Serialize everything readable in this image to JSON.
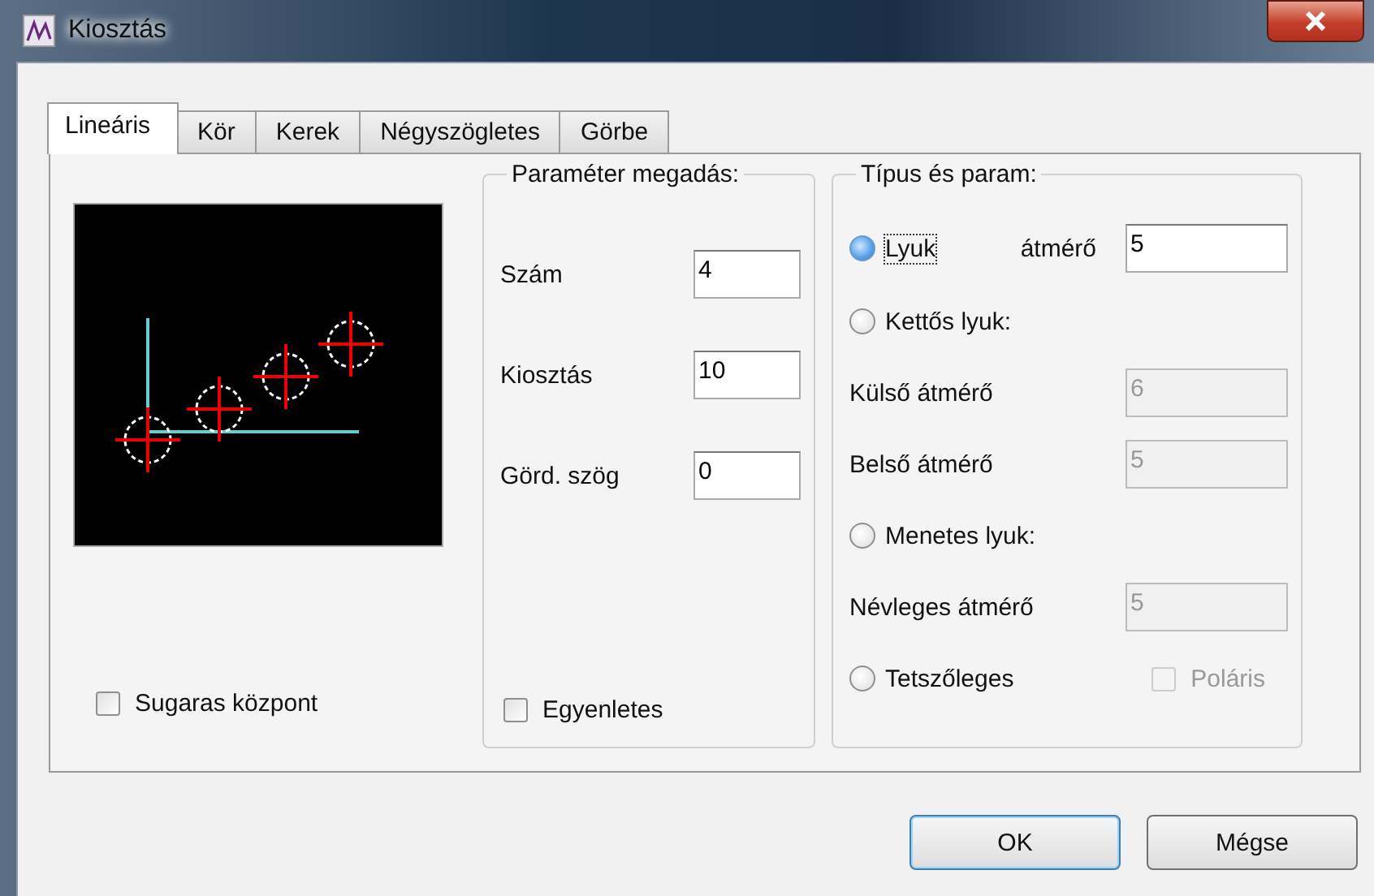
{
  "window": {
    "title": "Kiosztás"
  },
  "tabs": [
    {
      "label": "Lineáris",
      "selected": true
    },
    {
      "label": "Kör",
      "selected": false
    },
    {
      "label": "Kerek",
      "selected": false
    },
    {
      "label": "Négyszögletes",
      "selected": false
    },
    {
      "label": "Görbe",
      "selected": false
    }
  ],
  "radial_center": {
    "label": "Sugaras központ",
    "checked": false
  },
  "parameters": {
    "title": "Paraméter megadás:",
    "fields": [
      {
        "label": "Szám",
        "value": "4"
      },
      {
        "label": "Kiosztás",
        "value": "10"
      },
      {
        "label": "Görd. szög",
        "value": "0"
      }
    ],
    "even": {
      "label": "Egyenletes",
      "checked": false
    }
  },
  "type": {
    "title": "Típus és param:",
    "rows": [
      {
        "kind": "radio",
        "label": "Lyuk",
        "selected": true,
        "focused": true,
        "field_label": "átmérő",
        "value": "5",
        "disabled": false
      },
      {
        "kind": "radio",
        "label": "Kettős lyuk:",
        "selected": false
      },
      {
        "kind": "field",
        "label": "Külső átmérő",
        "value": "6",
        "disabled": true
      },
      {
        "kind": "field",
        "label": "Belső átmérő",
        "value": "5",
        "disabled": true
      },
      {
        "kind": "radio",
        "label": "Menetes lyuk:",
        "selected": false
      },
      {
        "kind": "field",
        "label": "Névleges átmérő",
        "value": "5",
        "disabled": true
      },
      {
        "kind": "radio",
        "label": "Tetszőleges",
        "selected": false,
        "check_label": "Poláris",
        "checked": false,
        "check_disabled": true
      }
    ]
  },
  "buttons": [
    {
      "label": "OK",
      "default": true
    },
    {
      "label": "Mégse",
      "default": false
    }
  ]
}
